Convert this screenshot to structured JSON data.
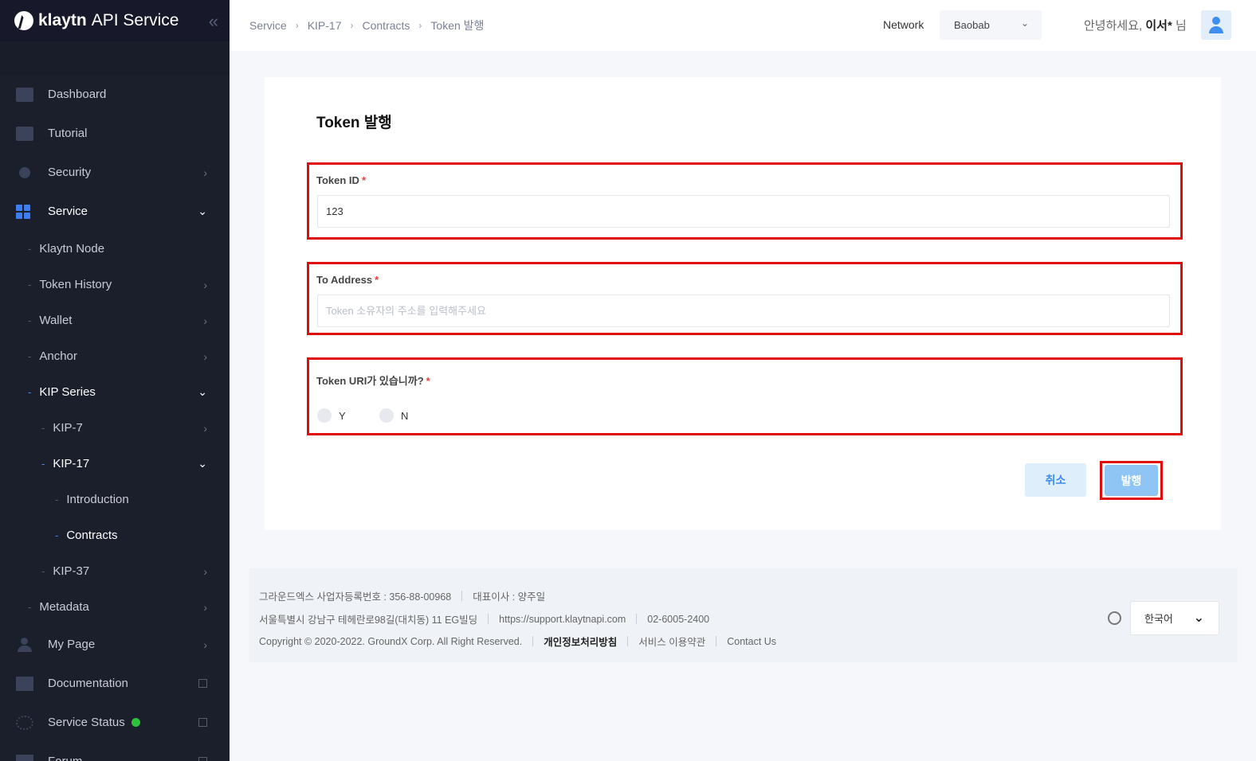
{
  "sidebar": {
    "logo_brand": "klaytn",
    "logo_suffix": "API Service",
    "collapse_glyph": "«",
    "items": [
      {
        "label": "Dashboard",
        "icon": "dashboard-icon"
      },
      {
        "label": "Tutorial",
        "icon": "video-icon"
      },
      {
        "label": "Security",
        "icon": "key-icon"
      },
      {
        "label": "Service",
        "icon": "grid-icon"
      },
      {
        "label": "Klaytn Node"
      },
      {
        "label": "Token History"
      },
      {
        "label": "Wallet"
      },
      {
        "label": "Anchor"
      },
      {
        "label": "KIP Series"
      },
      {
        "label": "KIP-7"
      },
      {
        "label": "KIP-17"
      },
      {
        "label": "Introduction"
      },
      {
        "label": "Contracts"
      },
      {
        "label": "KIP-37"
      },
      {
        "label": "Metadata"
      },
      {
        "label": "My Page",
        "icon": "user-icon"
      },
      {
        "label": "Documentation",
        "icon": "book-icon"
      },
      {
        "label": "Service Status",
        "icon": "status-icon",
        "status_color": "#2fc13d"
      },
      {
        "label": "Forum",
        "icon": "forum-icon"
      }
    ]
  },
  "header": {
    "breadcrumb": [
      "Service",
      "KIP-17",
      "Contracts",
      "Token 발행"
    ],
    "network_label": "Network",
    "network_value": "Baobab",
    "greeting_prefix": "안녕하세요,",
    "user_name": "이서*",
    "greeting_suffix": "님"
  },
  "form": {
    "title": "Token 발행",
    "token_id": {
      "label": "Token ID",
      "required": "*",
      "value": "123"
    },
    "to_address": {
      "label": "To Address",
      "required": "*",
      "placeholder": "Token 소유자의 주소를 입력해주세요"
    },
    "token_uri": {
      "label": "Token URI가 있습니까?",
      "required": "*",
      "options": [
        "Y",
        "N"
      ]
    },
    "cancel_label": "취소",
    "issue_label": "발행",
    "highlight_color": "#e10d0d",
    "accent_color": "#3d8ef0"
  },
  "footer": {
    "company": "그라운드엑스 사업자등록번호 : 356-88-00968",
    "ceo": "대표이사 : 양주일",
    "address": "서울특별시 강남구 테헤란로98길(대치동) 11 EG빌딩",
    "support_url": "https://support.klaytnapi.com",
    "phone": "02-6005-2400",
    "copyright": "Copyright © 2020-2022. GroundX Corp. All Right Reserved.",
    "privacy": "개인정보처리방침",
    "terms": "서비스 이용약관",
    "contact": "Contact Us",
    "language": "한국어"
  }
}
